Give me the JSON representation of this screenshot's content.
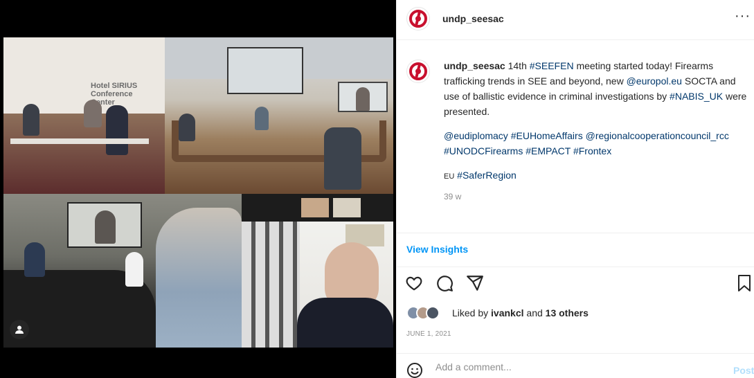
{
  "post": {
    "username": "undp_seesac",
    "more_label": "···",
    "collage_sign": "Hotel SIRIUS Conference Center"
  },
  "caption": {
    "username": "undp_seesac",
    "p1_a": " 14th ",
    "p1_tag1": "#SEEFEN",
    "p1_b": " meeting started today! Firearms trafficking trends in SEE and beyond, new ",
    "p1_mention1": "@europol.eu",
    "p1_c": " SOCTA and use of ballistic evidence in criminal investigations by ",
    "p1_tag2": "#NABIS_UK",
    "p1_d": " were presented.",
    "p2_m1": "@eudiplomacy",
    "p2_t1": "#EUHomeAffairs",
    "p2_m2": "@regionalcooperationcouncil_rcc",
    "p2_t2": "#UNODCFirearms",
    "p2_t3": "#EMPACT",
    "p2_t4": "#Frontex",
    "p3_eu": "EU",
    "p3_tag": "#SaferRegion",
    "ago": "39 w"
  },
  "insights_label": "View Insights",
  "icons": {
    "like": "heart-icon",
    "comment": "comment-icon",
    "share": "send-icon",
    "save": "bookmark-icon",
    "emoji": "emoji-icon",
    "user_tag": "user-tag-icon"
  },
  "likes": {
    "prefix": "Liked by ",
    "user": "ivankcl",
    "middle": " and ",
    "others": "13 others"
  },
  "date": "JUNE 1, 2021",
  "comment": {
    "placeholder": "Add a comment...",
    "post_label": "Post"
  },
  "colors": {
    "link": "#00376b",
    "accent": "#0095f6",
    "post_disabled": "#b2dffc",
    "logo_red": "#c8102e"
  }
}
